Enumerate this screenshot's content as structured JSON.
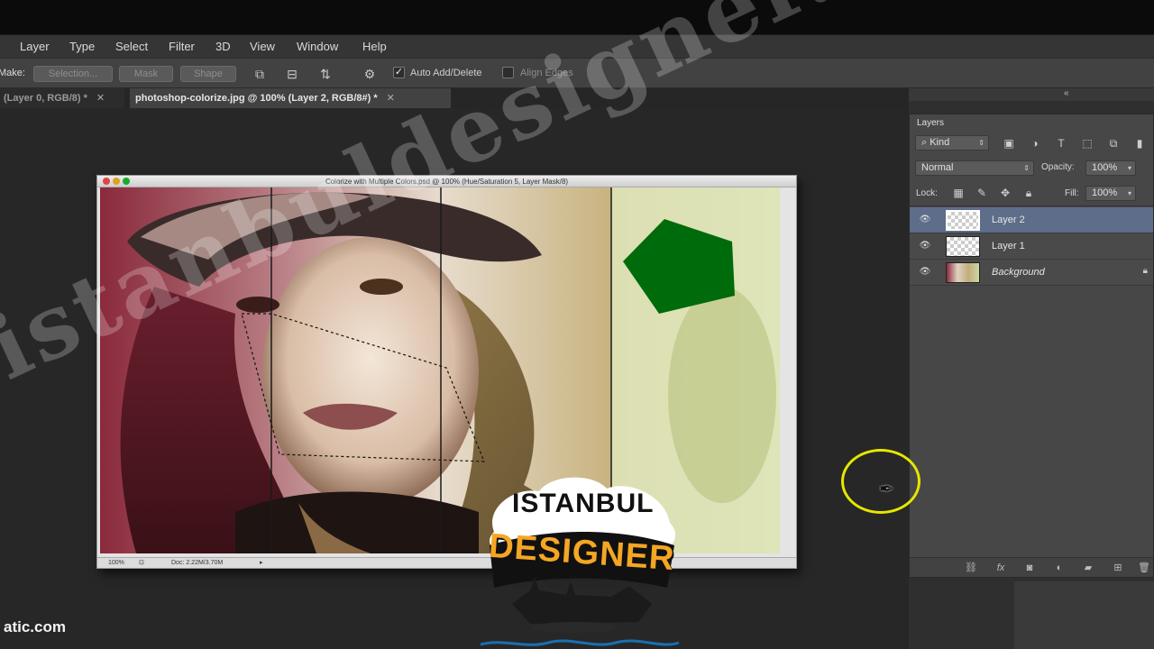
{
  "menu": [
    "Layer",
    "Type",
    "Select",
    "Filter",
    "3D",
    "View",
    "Window",
    "Help"
  ],
  "options": {
    "make_label": "Make:",
    "selection_btn": "Selection...",
    "mask_btn": "Mask",
    "shape_btn": "Shape",
    "auto_add_delete": "Auto Add/Delete",
    "align_edges": "Align Edges"
  },
  "tabs": [
    {
      "label": "(Layer 0, RGB/8) *"
    },
    {
      "label": "photoshop-colorize.jpg @ 100% (Layer 2, RGB/8#) *"
    }
  ],
  "document": {
    "title": "Colorize with Multiple Colors.psd @ 100% (Hue/Saturation 5, Layer Mask/8)",
    "zoom": "100%",
    "doc_size": "Doc: 2.22M/3.70M"
  },
  "layers_panel": {
    "title": "Layers",
    "kind_filter": "Kind",
    "blend_mode": "Normal",
    "opacity_label": "Opacity:",
    "opacity_value": "100%",
    "lock_label": "Lock:",
    "fill_label": "Fill:",
    "fill_value": "100%",
    "layers": [
      {
        "name": "Layer 2",
        "selected": true
      },
      {
        "name": "Layer 1",
        "selected": false
      },
      {
        "name": "Background",
        "selected": false,
        "locked": true
      }
    ]
  },
  "overlay": {
    "watermark": "istanbuldesigner.com",
    "logo_top": "ISTANBUL",
    "logo_bottom": "DESIGNER",
    "source_label": "atic.com"
  },
  "colors": {
    "accent_selected_layer": "#5d6d8a",
    "cursor_ring": "#e6e600",
    "shape_fill": "#006b0a",
    "logo_orange": "#f5a623"
  }
}
